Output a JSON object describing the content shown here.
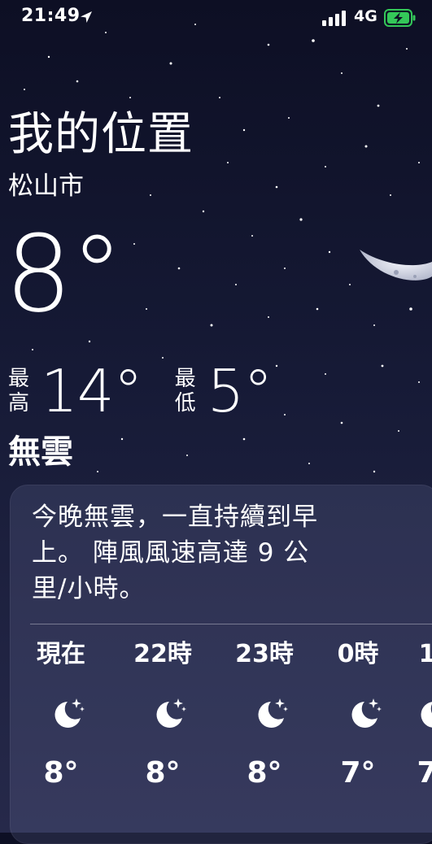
{
  "status_bar": {
    "time": "21:49",
    "network": "4G"
  },
  "header": {
    "location_title": "我的位置",
    "city": "松山市",
    "current_temp": "8°",
    "high_label": "最高",
    "high_value": "14°",
    "low_label": "最低",
    "low_value": "5°",
    "condition": "無雲"
  },
  "forecast_card": {
    "summary": "今晚無雲，一直持續到早上。 陣風風速高達 9 公里/小時。",
    "hours": [
      {
        "label": "現在",
        "icon": "moon-stars-icon",
        "temp": "8°"
      },
      {
        "label": "22時",
        "icon": "moon-stars-icon",
        "temp": "8°"
      },
      {
        "label": "23時",
        "icon": "moon-stars-icon",
        "temp": "8°"
      },
      {
        "label": "0時",
        "icon": "moon-stars-icon",
        "temp": "7°"
      },
      {
        "label": "1",
        "icon": "moon-stars-icon",
        "temp": "7"
      }
    ]
  },
  "colors": {
    "sky_top": "#0d0f24",
    "sky_bottom": "#26294a",
    "battery_green": "#34c759",
    "text": "#ffffff"
  }
}
